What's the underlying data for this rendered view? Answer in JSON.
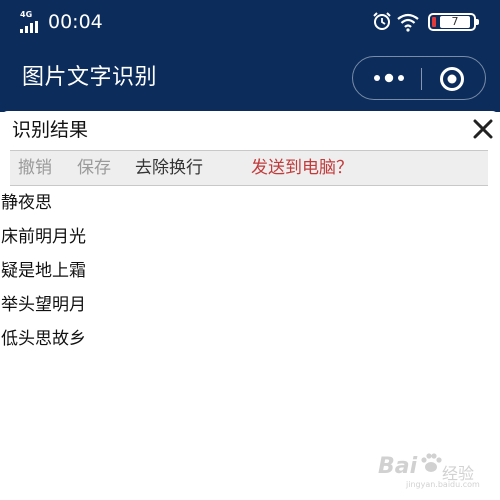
{
  "status_bar": {
    "network": "4G",
    "time": "00:04",
    "battery_level": "7",
    "icons": [
      "signal-icon",
      "alarm-icon",
      "wifi-icon",
      "battery-icon"
    ]
  },
  "header": {
    "title": "图片文字识别",
    "more_icon": "more-dots-icon",
    "close_icon": "mini-program-close-icon",
    "background": "#0c2c5c"
  },
  "result": {
    "title": "识别结果",
    "close_icon": "close-icon",
    "toolbar": {
      "undo_label": "撤销",
      "save_label": "保存",
      "remove_linebreaks_label": "去除换行",
      "send_to_pc_label": "发送到电脑？"
    },
    "lines": [
      "静夜思",
      "床前明月光",
      "疑是地上霜",
      "举头望明月",
      "低头思故乡"
    ]
  },
  "watermark": {
    "brand": "Bai",
    "brand_cn": "经验",
    "url": "jingyan.baidu.com"
  },
  "colors": {
    "header_bg": "#0c2c5c",
    "disabled_text": "#9a9a9a",
    "accent_red": "#c23b3b"
  }
}
